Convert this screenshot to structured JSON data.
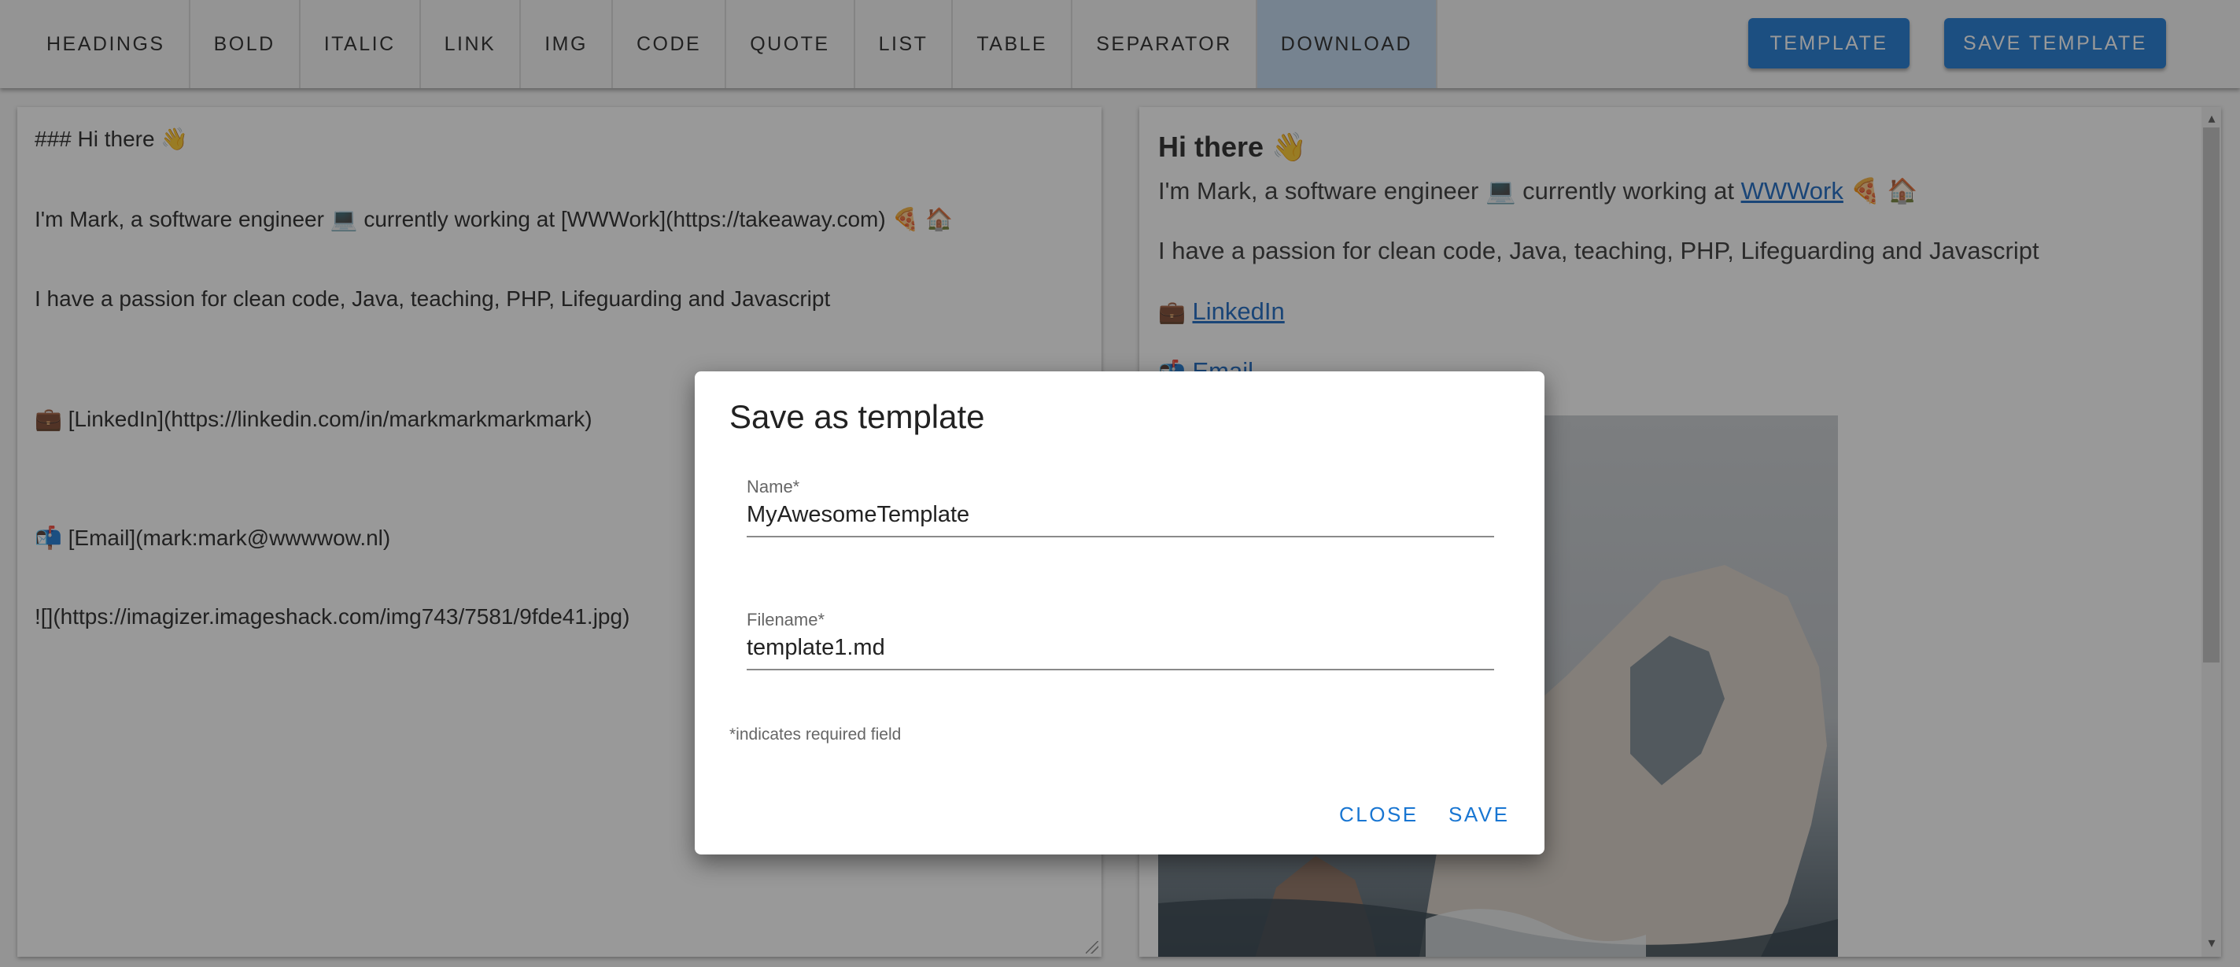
{
  "toolbar": {
    "items": [
      {
        "label": "HEADINGS"
      },
      {
        "label": "BOLD"
      },
      {
        "label": "ITALIC"
      },
      {
        "label": "LINK"
      },
      {
        "label": "IMG"
      },
      {
        "label": "CODE"
      },
      {
        "label": "QUOTE"
      },
      {
        "label": "LIST"
      },
      {
        "label": "TABLE"
      },
      {
        "label": "SEPARATOR"
      },
      {
        "label": "DOWNLOAD"
      }
    ],
    "template_label": "TEMPLATE",
    "save_template_label": "SAVE TEMPLATE"
  },
  "editor": {
    "lines": [
      "### Hi there 👋",
      "I'm Mark, a software engineer 💻 currently working at [WWWork](https://takeaway.com) 🍕 🏠",
      "I have a passion for clean code, Java, teaching, PHP, Lifeguarding and Javascript",
      "💼 [LinkedIn](https://linkedin.com/in/markmarkmarkmark)",
      "📬 [Email](mark:mark@wwwwow.nl)",
      "![](https://imagizer.imageshack.com/img743/7581/9fde41.jpg)"
    ]
  },
  "preview": {
    "heading": "Hi there 👋",
    "intro_prefix": "I'm Mark, a software engineer 💻 currently working at ",
    "intro_link": "WWWork",
    "intro_suffix": " 🍕 🏠",
    "passion": "I have a passion for clean code, Java, teaching, PHP, Lifeguarding and Javascript",
    "linkedin_emoji": "💼",
    "linkedin_label": "LinkedIn",
    "email_emoji": "📬",
    "email_label": "Email"
  },
  "dialog": {
    "title": "Save as template",
    "name_label": "Name*",
    "name_value": "MyAwesomeTemplate",
    "filename_label": "Filename*",
    "filename_value": "template1.md",
    "required_hint": "*indicates required field",
    "close_label": "CLOSE",
    "save_label": "SAVE"
  }
}
